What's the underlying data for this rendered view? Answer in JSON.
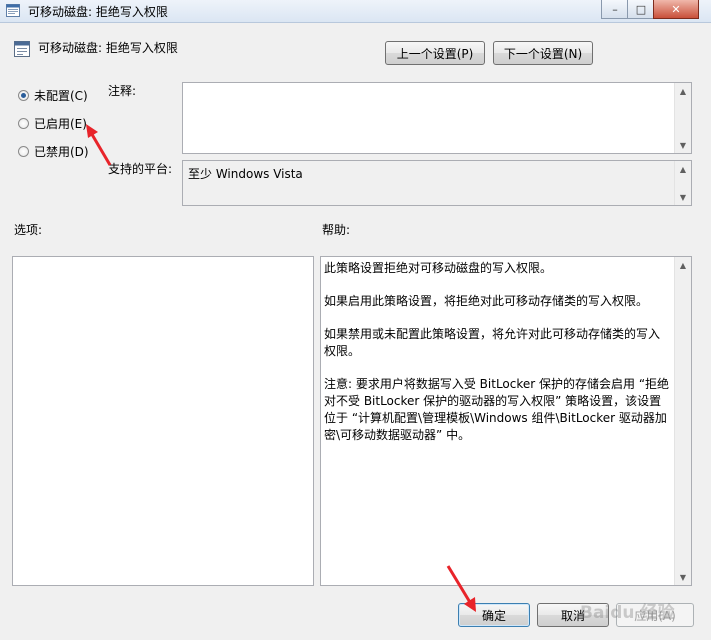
{
  "window": {
    "title": "可移动磁盘: 拒绝写入权限",
    "buttons": [
      "–",
      "□",
      "✕"
    ]
  },
  "header": {
    "title": "可移动磁盘: 拒绝写入权限",
    "prev_label": "上一个设置(P)",
    "next_label": "下一个设置(N)"
  },
  "state": {
    "options": [
      "未配置(C)",
      "已启用(E)",
      "已禁用(D)"
    ],
    "selected": "未配置(C)"
  },
  "comment": {
    "label": "注释:",
    "value": ""
  },
  "platform": {
    "label": "支持的平台:",
    "value": "至少 Windows Vista"
  },
  "options_panel": {
    "label": "选项:"
  },
  "help": {
    "label": "帮助:",
    "paragraphs": [
      "此策略设置拒绝对可移动磁盘的写入权限。",
      "如果启用此策略设置，将拒绝对此可移动存储类的写入权限。",
      "如果禁用或未配置此策略设置，将允许对此可移动存储类的写入权限。",
      "注意: 要求用户将数据写入受 BitLocker 保护的存储会启用 “拒绝对不受 BitLocker 保护的驱动器的写入权限” 策略设置，该设置位于 “计算机配置\\管理模板\\Windows 组件\\BitLocker 驱动器加密\\可移动数据驱动器” 中。"
    ]
  },
  "footer": {
    "ok_label": "确定",
    "cancel_label": "取消",
    "apply_label": "应用(A)"
  },
  "watermark": "Baidu 经验",
  "colors": {
    "annotation_arrow": "#e8242a",
    "titlebar": "#dbe6f3"
  }
}
